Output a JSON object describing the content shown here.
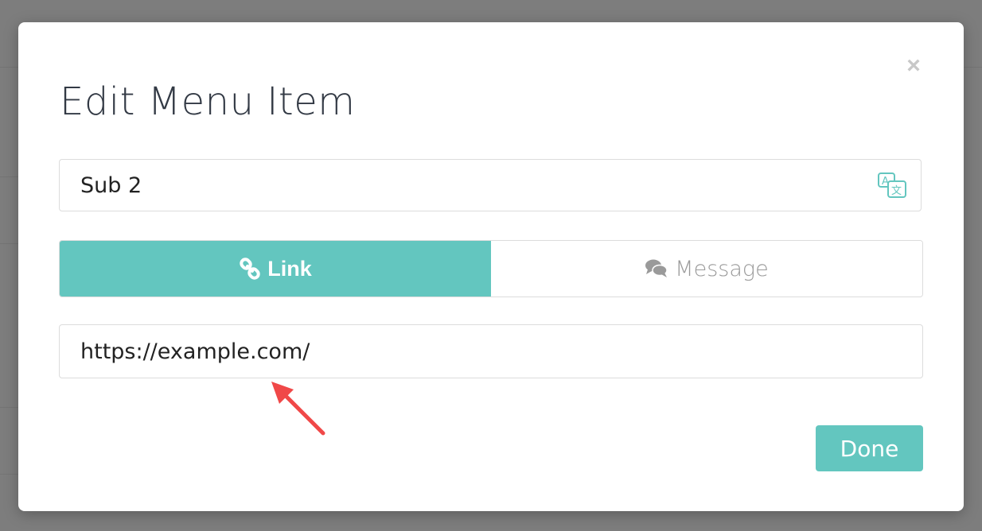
{
  "modal": {
    "title": "Edit Menu Item",
    "close_label": "×"
  },
  "name_field": {
    "value": "Sub 2",
    "icon": "translate-icon"
  },
  "tabs": [
    {
      "label": "Link",
      "icon": "link-icon",
      "active": true
    },
    {
      "label": "Message",
      "icon": "chat-bubbles-icon",
      "active": false
    }
  ],
  "url_field": {
    "value": "https://example.com/"
  },
  "footer": {
    "done_label": "Done"
  },
  "colors": {
    "accent": "#63c6bf",
    "overlay": "#7d7d7d",
    "annotation": "#f04848"
  }
}
